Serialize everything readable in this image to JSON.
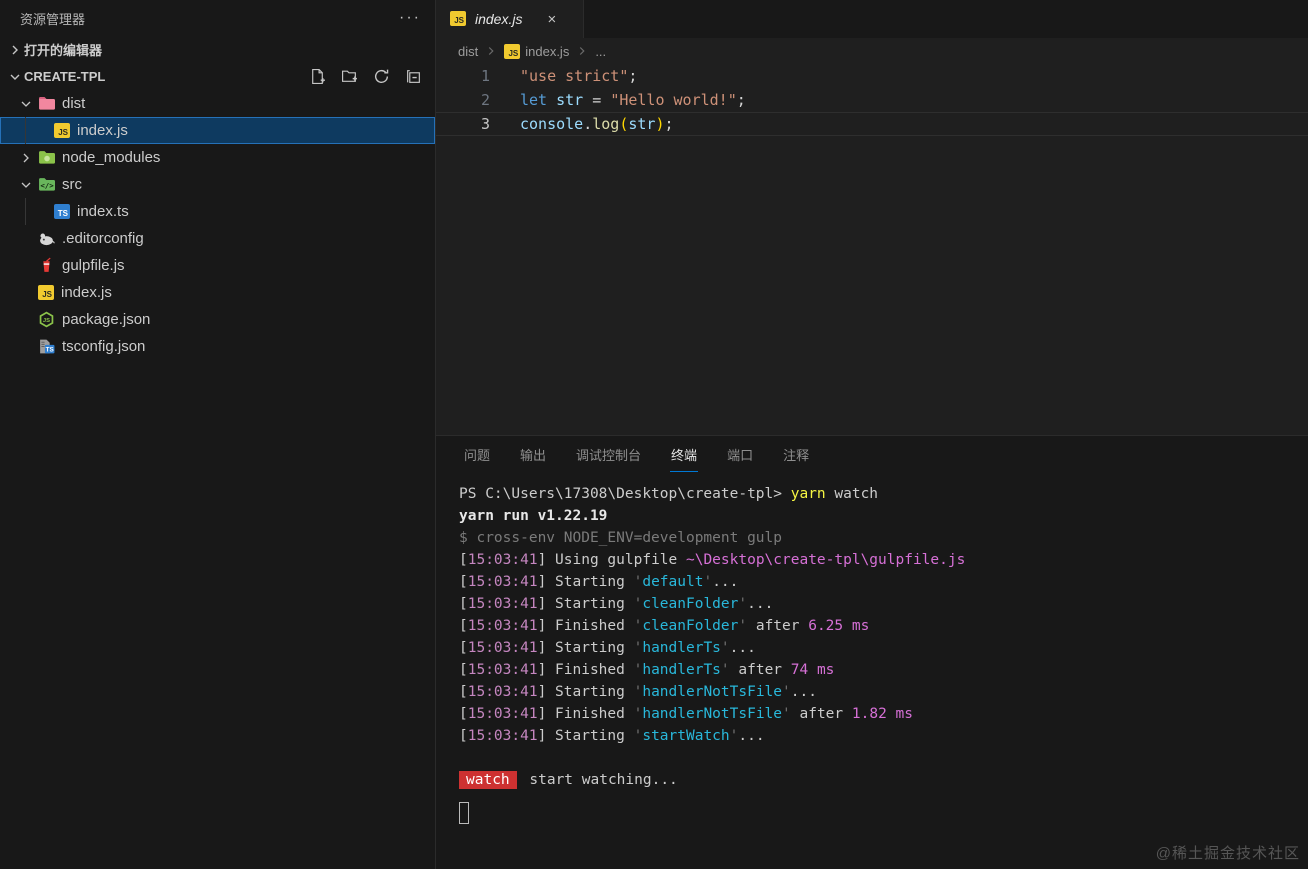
{
  "colors": {
    "accent": "#0078d4",
    "selection_bg": "#0e3a60",
    "selection_border": "#2571b8",
    "badge_red": "#cd3131",
    "js_icon": "#f1ca2f",
    "ts_icon": "#2f7fd0",
    "dist_folder": "#f2879f",
    "node_folder": "#8bc34a",
    "src_folder": "#69b65c"
  },
  "sidebar": {
    "title": "资源管理器",
    "more_icon": "···",
    "open_editors_label": "打开的编辑器",
    "project_label": "CREATE-TPL",
    "actions": [
      {
        "name": "new-file"
      },
      {
        "name": "new-folder"
      },
      {
        "name": "refresh"
      },
      {
        "name": "collapse-all"
      }
    ],
    "tree": [
      {
        "label": "dist",
        "icon": "folder-dist",
        "type": "folder",
        "expanded": true,
        "depth": 0,
        "selected": false
      },
      {
        "label": "index.js",
        "icon": "js",
        "type": "file",
        "depth": 1,
        "selected": true,
        "guide": true
      },
      {
        "label": "node_modules",
        "icon": "folder-node",
        "type": "folder",
        "expanded": false,
        "depth": 0,
        "selected": false
      },
      {
        "label": "src",
        "icon": "folder-src",
        "type": "folder",
        "expanded": true,
        "depth": 0,
        "selected": false
      },
      {
        "label": "index.ts",
        "icon": "ts",
        "type": "file",
        "depth": 1,
        "selected": false,
        "guide": true
      },
      {
        "label": ".editorconfig",
        "icon": "editorconfig",
        "type": "file",
        "depth": 0,
        "selected": false
      },
      {
        "label": "gulpfile.js",
        "icon": "gulp",
        "type": "file",
        "depth": 0,
        "selected": false
      },
      {
        "label": "index.js",
        "icon": "js",
        "type": "file",
        "depth": 0,
        "selected": false
      },
      {
        "label": "package.json",
        "icon": "nodejs",
        "type": "file",
        "depth": 0,
        "selected": false
      },
      {
        "label": "tsconfig.json",
        "icon": "tsconfig",
        "type": "file",
        "depth": 0,
        "selected": false
      }
    ]
  },
  "editor": {
    "tab": {
      "label": "index.js",
      "icon": "js",
      "close_icon": "×"
    },
    "breadcrumb": [
      {
        "label": "dist"
      },
      {
        "label": "index.js",
        "icon": "js"
      },
      {
        "label": "..."
      }
    ],
    "lines": [
      {
        "num": "1",
        "active": false,
        "tokens": [
          {
            "t": "\"use strict\"",
            "c": "string"
          },
          {
            "t": ";",
            "c": "plain"
          }
        ]
      },
      {
        "num": "2",
        "active": false,
        "tokens": [
          {
            "t": "let",
            "c": "keyword"
          },
          {
            "t": " ",
            "c": "plain"
          },
          {
            "t": "str",
            "c": "variable"
          },
          {
            "t": " = ",
            "c": "plain"
          },
          {
            "t": "\"Hello world!\"",
            "c": "string"
          },
          {
            "t": ";",
            "c": "plain"
          }
        ]
      },
      {
        "num": "3",
        "active": true,
        "tokens": [
          {
            "t": "console",
            "c": "variable"
          },
          {
            "t": ".",
            "c": "plain"
          },
          {
            "t": "log",
            "c": "function"
          },
          {
            "t": "(",
            "c": "bracket"
          },
          {
            "t": "str",
            "c": "variable"
          },
          {
            "t": ")",
            "c": "bracket"
          },
          {
            "t": ";",
            "c": "plain"
          }
        ]
      }
    ]
  },
  "panel": {
    "tabs": [
      {
        "label": "问题",
        "active": false
      },
      {
        "label": "输出",
        "active": false
      },
      {
        "label": "调试控制台",
        "active": false
      },
      {
        "label": "终端",
        "active": true
      },
      {
        "label": "端口",
        "active": false
      },
      {
        "label": "注释",
        "active": false
      }
    ],
    "terminal": [
      {
        "segs": [
          {
            "t": "PS C:\\Users\\17308\\Desktop\\create-tpl> ",
            "c": "white"
          },
          {
            "t": "yarn",
            "c": "yellow"
          },
          {
            "t": " watch",
            "c": "white"
          }
        ]
      },
      {
        "segs": [
          {
            "t": "yarn run v1.22.19",
            "c": "bold"
          }
        ]
      },
      {
        "segs": [
          {
            "t": "$ cross-env NODE_ENV=development gulp",
            "c": "gray"
          }
        ]
      },
      {
        "segs": [
          {
            "t": "[",
            "c": "white"
          },
          {
            "t": "15:03:41",
            "c": "time"
          },
          {
            "t": "] Using gulpfile ",
            "c": "white"
          },
          {
            "t": "~\\Desktop\\create-tpl\\gulpfile.js",
            "c": "path"
          }
        ]
      },
      {
        "segs": [
          {
            "t": "[",
            "c": "white"
          },
          {
            "t": "15:03:41",
            "c": "time"
          },
          {
            "t": "] Starting ",
            "c": "white"
          },
          {
            "t": "'",
            "c": "quote"
          },
          {
            "t": "default",
            "c": "cyan"
          },
          {
            "t": "'",
            "c": "quote"
          },
          {
            "t": "...",
            "c": "white"
          }
        ]
      },
      {
        "segs": [
          {
            "t": "[",
            "c": "white"
          },
          {
            "t": "15:03:41",
            "c": "time"
          },
          {
            "t": "] Starting ",
            "c": "white"
          },
          {
            "t": "'",
            "c": "quote"
          },
          {
            "t": "cleanFolder",
            "c": "cyan"
          },
          {
            "t": "'",
            "c": "quote"
          },
          {
            "t": "...",
            "c": "white"
          }
        ]
      },
      {
        "segs": [
          {
            "t": "[",
            "c": "white"
          },
          {
            "t": "15:03:41",
            "c": "time"
          },
          {
            "t": "] Finished ",
            "c": "white"
          },
          {
            "t": "'",
            "c": "quote"
          },
          {
            "t": "cleanFolder",
            "c": "cyan"
          },
          {
            "t": "'",
            "c": "quote"
          },
          {
            "t": " after ",
            "c": "white"
          },
          {
            "t": "6.25 ms",
            "c": "num"
          }
        ]
      },
      {
        "segs": [
          {
            "t": "[",
            "c": "white"
          },
          {
            "t": "15:03:41",
            "c": "time"
          },
          {
            "t": "] Starting ",
            "c": "white"
          },
          {
            "t": "'",
            "c": "quote"
          },
          {
            "t": "handlerTs",
            "c": "cyan"
          },
          {
            "t": "'",
            "c": "quote"
          },
          {
            "t": "...",
            "c": "white"
          }
        ]
      },
      {
        "segs": [
          {
            "t": "[",
            "c": "white"
          },
          {
            "t": "15:03:41",
            "c": "time"
          },
          {
            "t": "] Finished ",
            "c": "white"
          },
          {
            "t": "'",
            "c": "quote"
          },
          {
            "t": "handlerTs",
            "c": "cyan"
          },
          {
            "t": "'",
            "c": "quote"
          },
          {
            "t": " after ",
            "c": "white"
          },
          {
            "t": "74 ms",
            "c": "num"
          }
        ]
      },
      {
        "segs": [
          {
            "t": "[",
            "c": "white"
          },
          {
            "t": "15:03:41",
            "c": "time"
          },
          {
            "t": "] Starting ",
            "c": "white"
          },
          {
            "t": "'",
            "c": "quote"
          },
          {
            "t": "handlerNotTsFile",
            "c": "cyan"
          },
          {
            "t": "'",
            "c": "quote"
          },
          {
            "t": "...",
            "c": "white"
          }
        ]
      },
      {
        "segs": [
          {
            "t": "[",
            "c": "white"
          },
          {
            "t": "15:03:41",
            "c": "time"
          },
          {
            "t": "] Finished ",
            "c": "white"
          },
          {
            "t": "'",
            "c": "quote"
          },
          {
            "t": "handlerNotTsFile",
            "c": "cyan"
          },
          {
            "t": "'",
            "c": "quote"
          },
          {
            "t": " after ",
            "c": "white"
          },
          {
            "t": "1.82 ms",
            "c": "num"
          }
        ]
      },
      {
        "segs": [
          {
            "t": "[",
            "c": "white"
          },
          {
            "t": "15:03:41",
            "c": "time"
          },
          {
            "t": "] Starting ",
            "c": "white"
          },
          {
            "t": "'",
            "c": "quote"
          },
          {
            "t": "startWatch",
            "c": "cyan"
          },
          {
            "t": "'",
            "c": "quote"
          },
          {
            "t": "...",
            "c": "white"
          }
        ]
      },
      {
        "blank": true
      },
      {
        "segs": [
          {
            "t": "watch",
            "c": "badge"
          },
          {
            "t": " start watching...",
            "c": "white"
          }
        ]
      }
    ]
  },
  "watermark": "@稀土掘金技术社区"
}
